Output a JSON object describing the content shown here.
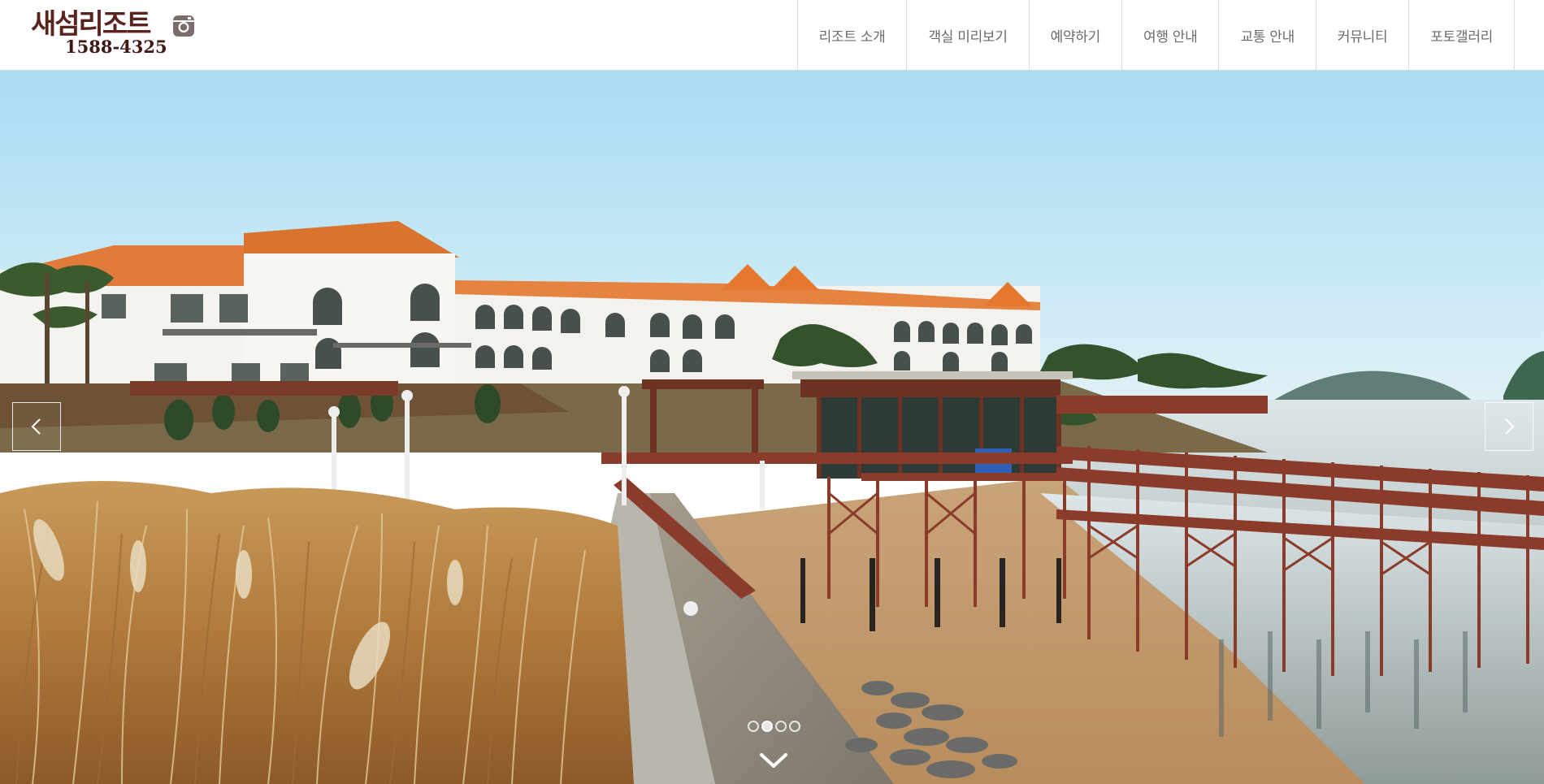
{
  "header": {
    "logo_name": "새섬리조트",
    "logo_phone": "1588-4325",
    "social_icon": "instagram-icon"
  },
  "nav": {
    "items": [
      {
        "label": "리조트 소개"
      },
      {
        "label": "객실 미리보기"
      },
      {
        "label": "예약하기"
      },
      {
        "label": "여행 안내"
      },
      {
        "label": "교통 안내"
      },
      {
        "label": "커뮤니티"
      },
      {
        "label": "포토갤러리"
      }
    ]
  },
  "hero": {
    "prev_icon": "chevron-left-icon",
    "next_icon": "chevron-right-icon",
    "scroll_icon": "chevron-down-icon",
    "slide_count": 4,
    "active_slide": 1
  },
  "colors": {
    "logo": "#5b2320",
    "nav_text": "#6b6b6b",
    "divider": "#dcdcdc",
    "roof": "#e07a36",
    "deck": "#8a3b2a"
  }
}
